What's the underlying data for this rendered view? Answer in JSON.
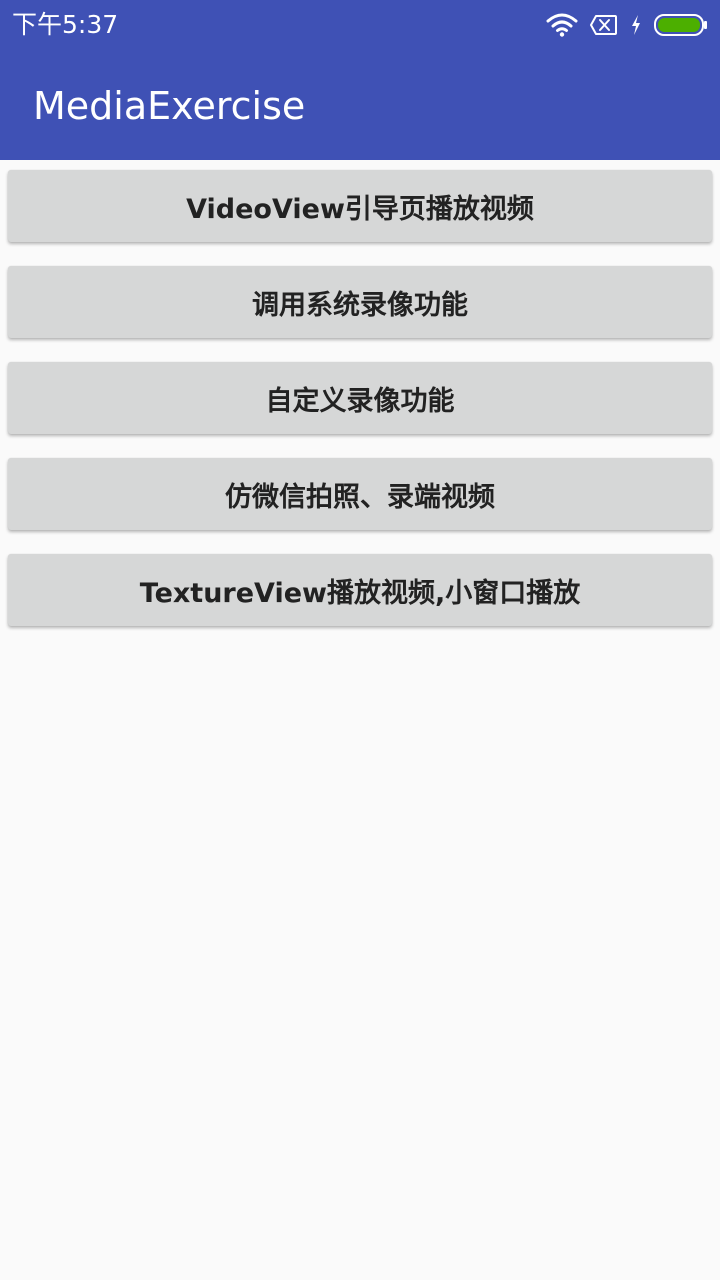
{
  "status_bar": {
    "time": "下午5:37",
    "icons": [
      "wifi-icon",
      "no-sim-icon",
      "charging-icon",
      "battery-icon"
    ],
    "battery_level_fraction": 1.0,
    "battery_color": "#4caf00"
  },
  "app_bar": {
    "title": "MediaExercise",
    "color": "#3f51b5"
  },
  "buttons": [
    {
      "label": "VideoView引导页播放视频"
    },
    {
      "label": "调用系统录像功能"
    },
    {
      "label": "自定义录像功能"
    },
    {
      "label": "仿微信拍照、录端视频"
    },
    {
      "label": "TextureView播放视频,小窗口播放"
    }
  ]
}
